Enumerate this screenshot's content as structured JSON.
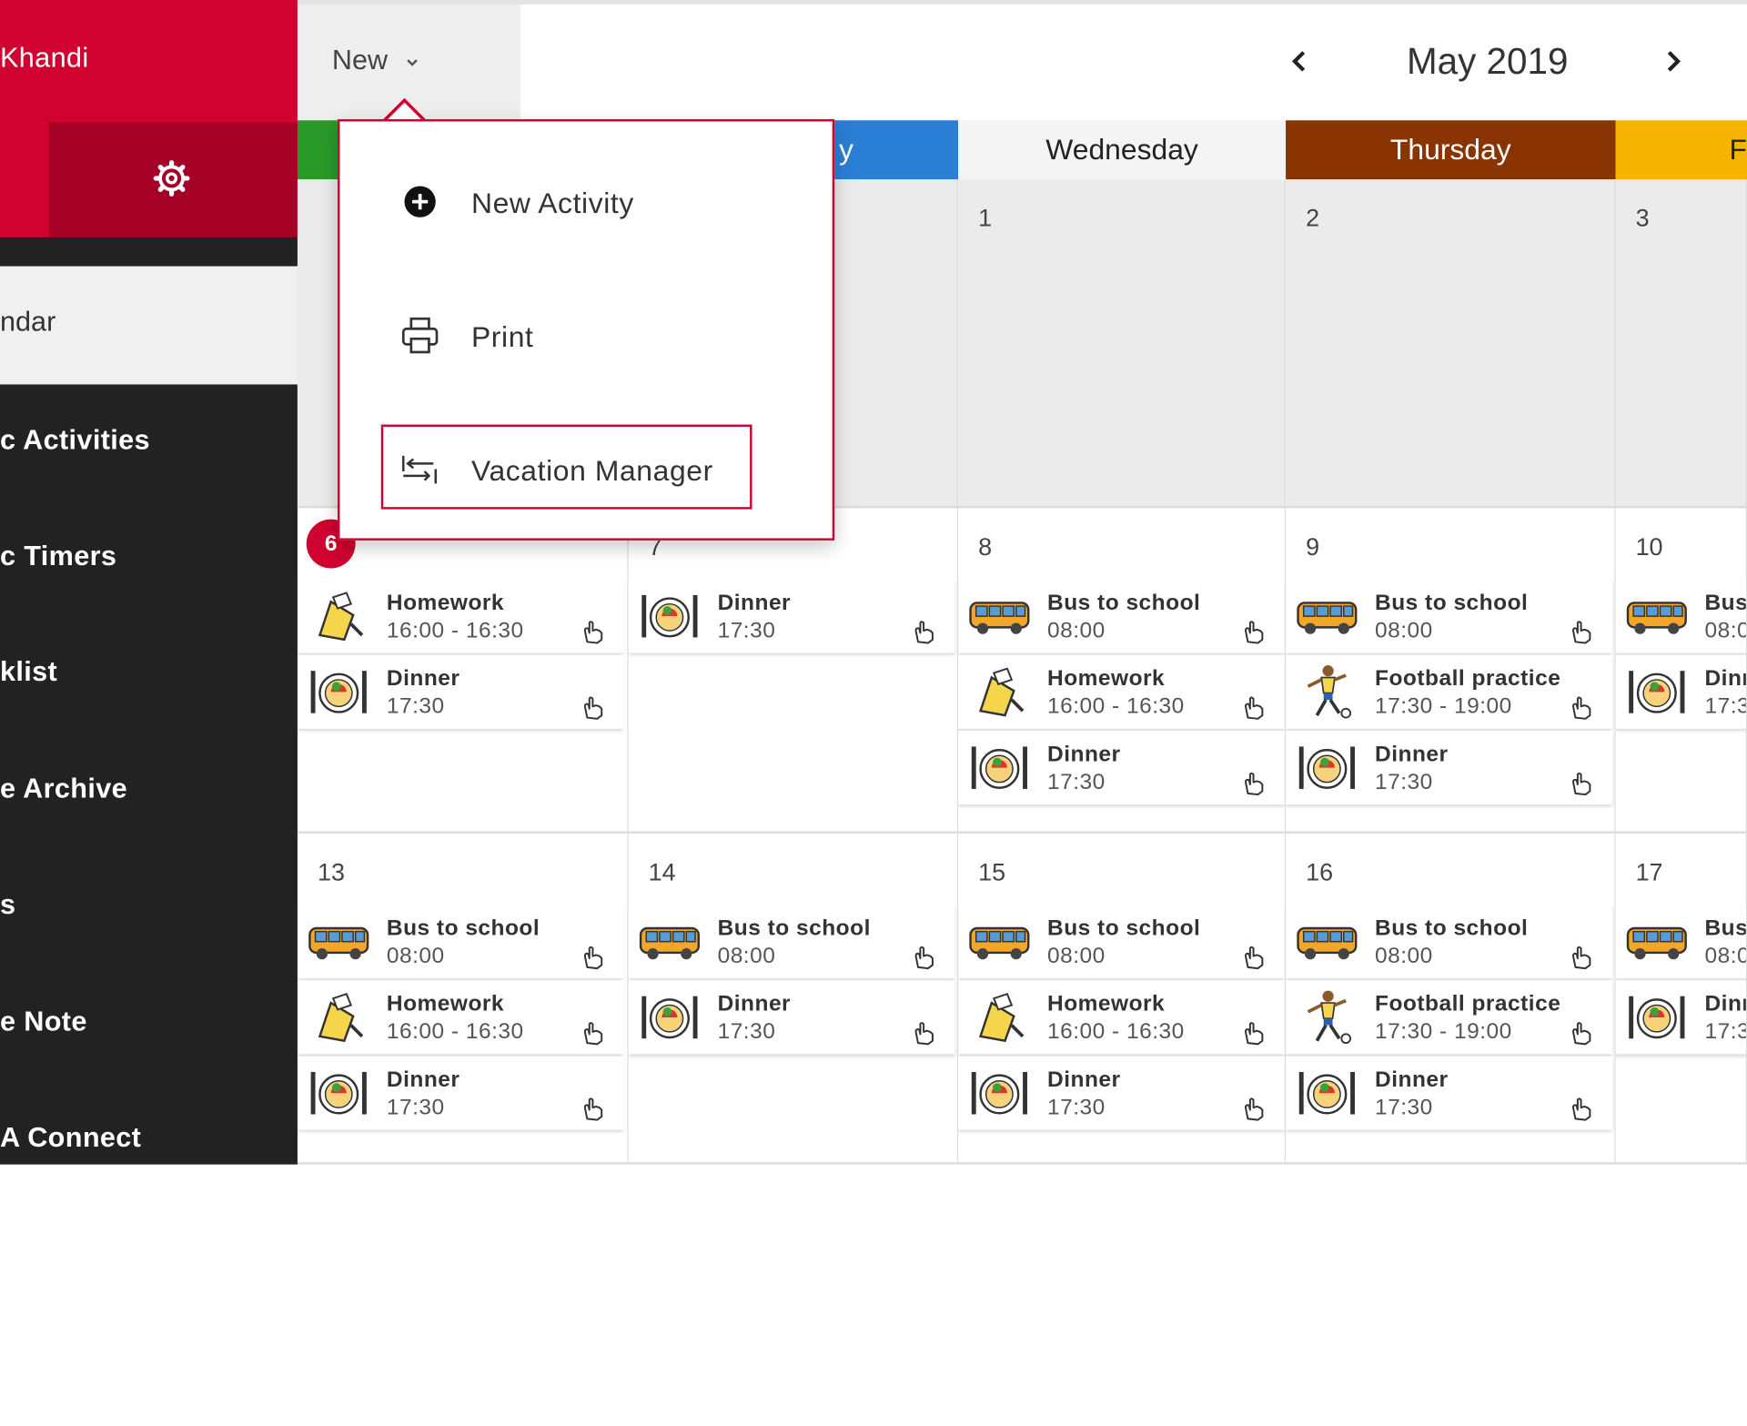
{
  "sidebar": {
    "user_name": "Khandi",
    "calendar_label": "ndar",
    "items": [
      {
        "label": "c Activities"
      },
      {
        "label": "c Timers"
      },
      {
        "label": "klist"
      },
      {
        "label": "e Archive"
      },
      {
        "label": "s"
      },
      {
        "label": "e Note"
      },
      {
        "label": "A Connect"
      }
    ],
    "icons": {
      "settings": "gear-icon"
    },
    "colors": {
      "header": "#d0022f",
      "header_dark": "#a50025",
      "menu_bg": "#222222",
      "active_bg": "#f0f0f0"
    }
  },
  "toolbar": {
    "new_label": "New",
    "month_label": "May 2019",
    "icons": {
      "prev": "chevron-left-icon",
      "next": "chevron-right-icon",
      "new_dropdown": "chevron-down-icon"
    }
  },
  "new_menu": {
    "items": [
      {
        "label": "New Activity",
        "icon": "plus-circle-icon"
      },
      {
        "label": "Print",
        "icon": "printer-icon"
      },
      {
        "label": "Vacation Manager",
        "icon": "vacation-manager-icon",
        "highlighted": true
      }
    ]
  },
  "day_headers": [
    {
      "label": "",
      "color": "#2a9a2a"
    },
    {
      "label": "y",
      "color": "#2a7fd4"
    },
    {
      "label": "Wednesday",
      "color": "#f4f4f4"
    },
    {
      "label": "Thursday",
      "color": "#8a3303"
    },
    {
      "label": "F",
      "color": "#f6b400"
    }
  ],
  "weeks": [
    {
      "days": [
        {
          "num": "",
          "grey": true,
          "today": false,
          "activities": []
        },
        {
          "num": "",
          "grey": true,
          "today": false,
          "activities": []
        },
        {
          "num": "1",
          "grey": true,
          "today": false,
          "activities": []
        },
        {
          "num": "2",
          "grey": true,
          "today": false,
          "activities": []
        },
        {
          "num": "3",
          "grey": true,
          "today": false,
          "activities": []
        }
      ]
    },
    {
      "days": [
        {
          "num": "6",
          "grey": false,
          "today": true,
          "activities": [
            {
              "title": "Homework",
              "time": "16:00 - 16:30",
              "icon": "homework-icon"
            },
            {
              "title": "Dinner",
              "time": "17:30",
              "icon": "dinner-icon"
            }
          ]
        },
        {
          "num": "7",
          "grey": false,
          "today": false,
          "activities": [
            {
              "title": "Dinner",
              "time": "17:30",
              "icon": "dinner-icon"
            }
          ]
        },
        {
          "num": "8",
          "grey": false,
          "today": false,
          "activities": [
            {
              "title": "Bus to school",
              "time": "08:00",
              "icon": "bus-icon"
            },
            {
              "title": "Homework",
              "time": "16:00 - 16:30",
              "icon": "homework-icon"
            },
            {
              "title": "Dinner",
              "time": "17:30",
              "icon": "dinner-icon"
            }
          ]
        },
        {
          "num": "9",
          "grey": false,
          "today": false,
          "activities": [
            {
              "title": "Bus to school",
              "time": "08:00",
              "icon": "bus-icon"
            },
            {
              "title": "Football practice",
              "time": "17:30 - 19:00",
              "icon": "football-icon"
            },
            {
              "title": "Dinner",
              "time": "17:30",
              "icon": "dinner-icon"
            }
          ]
        },
        {
          "num": "10",
          "grey": false,
          "today": false,
          "activities": [
            {
              "title": "Bus",
              "time": "08:0",
              "icon": "bus-icon"
            },
            {
              "title": "Dinr",
              "time": "17:3",
              "icon": "dinner-icon"
            }
          ]
        }
      ]
    },
    {
      "days": [
        {
          "num": "13",
          "grey": false,
          "today": false,
          "activities": [
            {
              "title": "Bus to school",
              "time": "08:00",
              "icon": "bus-icon"
            },
            {
              "title": "Homework",
              "time": "16:00 - 16:30",
              "icon": "homework-icon"
            },
            {
              "title": "Dinner",
              "time": "17:30",
              "icon": "dinner-icon"
            }
          ]
        },
        {
          "num": "14",
          "grey": false,
          "today": false,
          "activities": [
            {
              "title": "Bus to school",
              "time": "08:00",
              "icon": "bus-icon"
            },
            {
              "title": "Dinner",
              "time": "17:30",
              "icon": "dinner-icon"
            }
          ]
        },
        {
          "num": "15",
          "grey": false,
          "today": false,
          "activities": [
            {
              "title": "Bus to school",
              "time": "08:00",
              "icon": "bus-icon"
            },
            {
              "title": "Homework",
              "time": "16:00 - 16:30",
              "icon": "homework-icon"
            },
            {
              "title": "Dinner",
              "time": "17:30",
              "icon": "dinner-icon"
            }
          ]
        },
        {
          "num": "16",
          "grey": false,
          "today": false,
          "activities": [
            {
              "title": "Bus to school",
              "time": "08:00",
              "icon": "bus-icon"
            },
            {
              "title": "Football practice",
              "time": "17:30 - 19:00",
              "icon": "football-icon"
            },
            {
              "title": "Dinner",
              "time": "17:30",
              "icon": "dinner-icon"
            }
          ]
        },
        {
          "num": "17",
          "grey": false,
          "today": false,
          "activities": [
            {
              "title": "Bus",
              "time": "08:0",
              "icon": "bus-icon"
            },
            {
              "title": "Dinr",
              "time": "17:3",
              "icon": "dinner-icon"
            }
          ]
        }
      ]
    }
  ]
}
